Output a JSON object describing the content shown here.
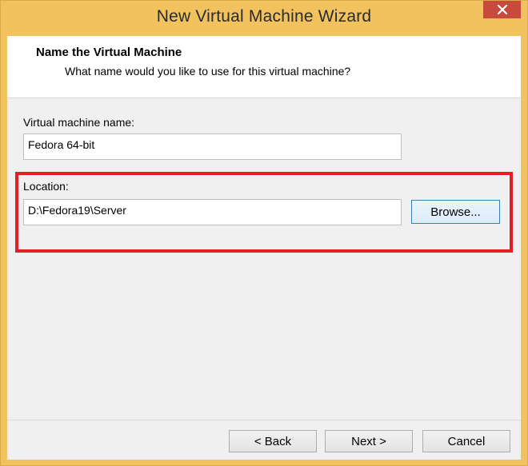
{
  "window": {
    "title": "New Virtual Machine Wizard",
    "close_icon": "close-icon"
  },
  "header": {
    "title": "Name the Virtual Machine",
    "subtitle": "What name would you like to use for this virtual machine?"
  },
  "form": {
    "name_label": "Virtual machine name:",
    "name_value": "Fedora 64-bit",
    "location_label": "Location:",
    "location_value": "D:\\Fedora19\\Server",
    "browse_label": "Browse..."
  },
  "footer": {
    "back_label": "< Back",
    "next_label": "Next >",
    "cancel_label": "Cancel"
  },
  "colors": {
    "titlebar": "#f2c25e",
    "close_button": "#c74a3c",
    "highlight": "#e31e24"
  }
}
